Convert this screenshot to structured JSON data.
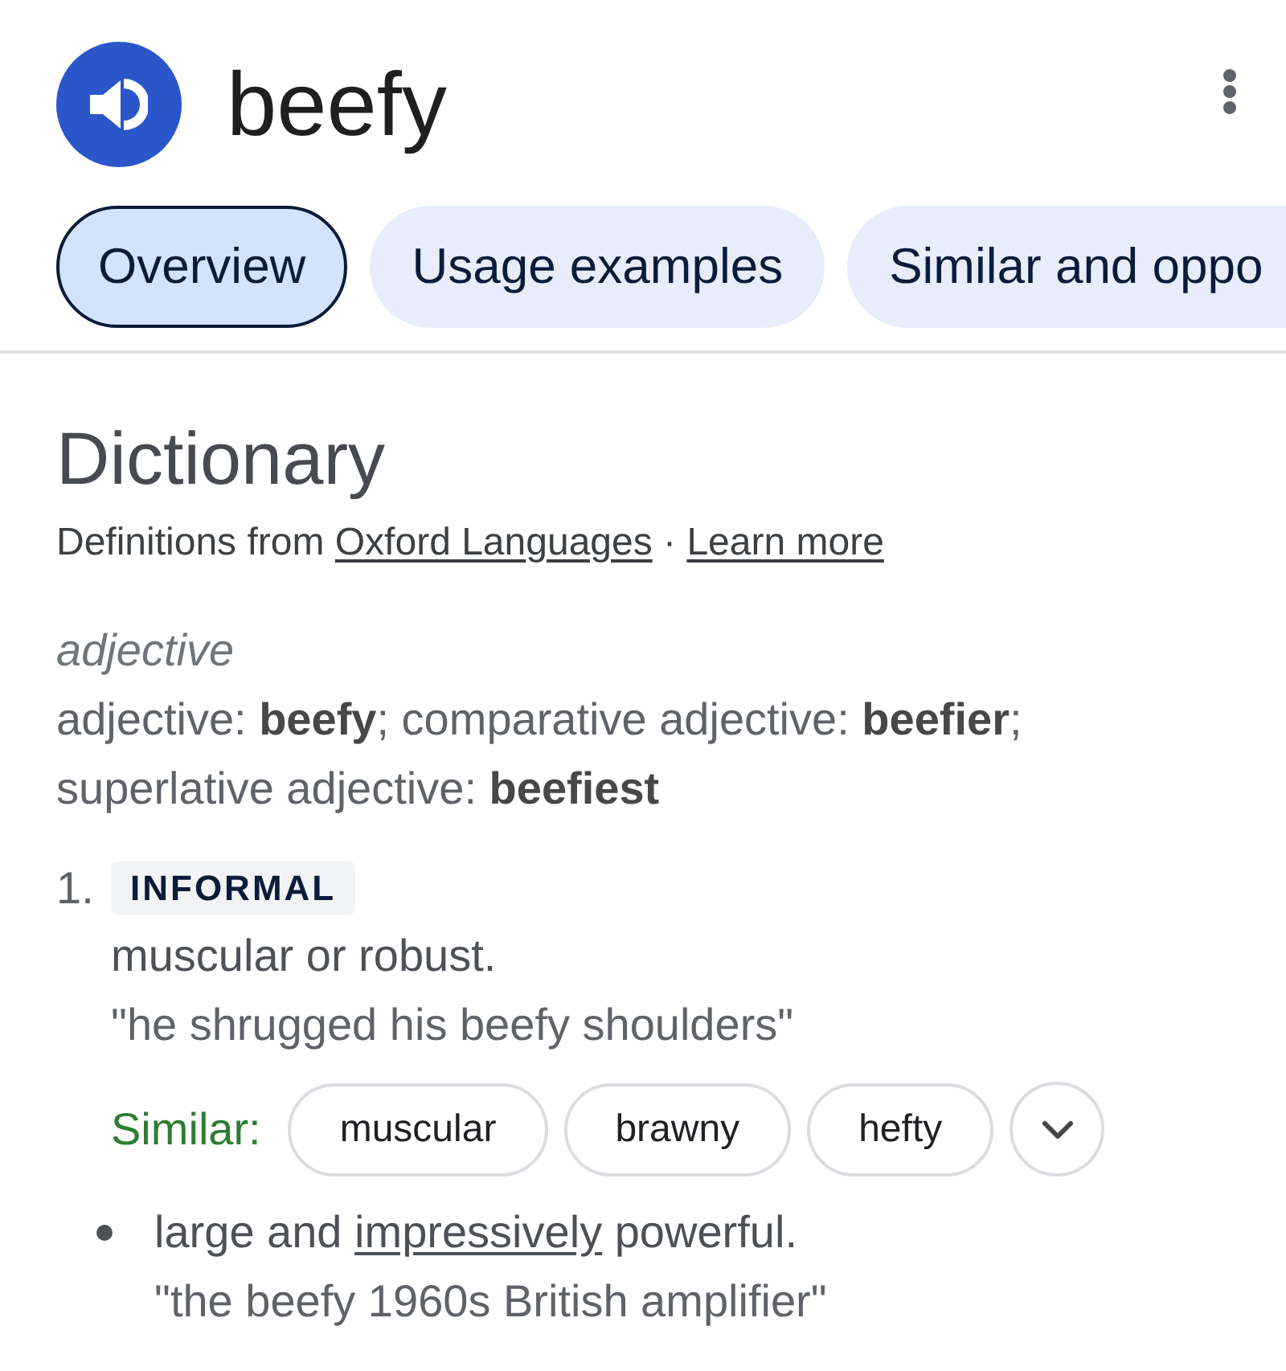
{
  "header": {
    "word": "beefy"
  },
  "tabs": [
    {
      "label": "Overview",
      "selected": true
    },
    {
      "label": "Usage examples",
      "selected": false
    },
    {
      "label": "Similar and oppo",
      "selected": false
    }
  ],
  "dictionary": {
    "title": "Dictionary",
    "source": [
      {
        "kind": "text",
        "text": "Definitions from "
      },
      {
        "kind": "link",
        "text": "Oxford Languages"
      },
      {
        "kind": "text",
        "text": " · "
      },
      {
        "kind": "link",
        "text": "Learn more"
      }
    ],
    "part_of_speech": "adjective",
    "forms": [
      "adjective: **beefy**; comparative adjective: **beefier**;",
      "superlative adjective: **beefiest**"
    ],
    "senses": [
      {
        "number": "1.",
        "label": "INFORMAL",
        "definition": "muscular or robust.",
        "example": "\"he shrugged his beefy shoulders\"",
        "similar": {
          "label": "Similar:",
          "words": [
            "muscular",
            "brawny",
            "hefty"
          ]
        },
        "subsenses": [
          {
            "parts": [
              {
                "kind": "text",
                "text": "large and "
              },
              {
                "kind": "link",
                "text": "impressively"
              },
              {
                "kind": "text",
                "text": " powerful."
              }
            ],
            "example": "\"the beefy 1960s British amplifier\""
          }
        ]
      }
    ]
  }
}
